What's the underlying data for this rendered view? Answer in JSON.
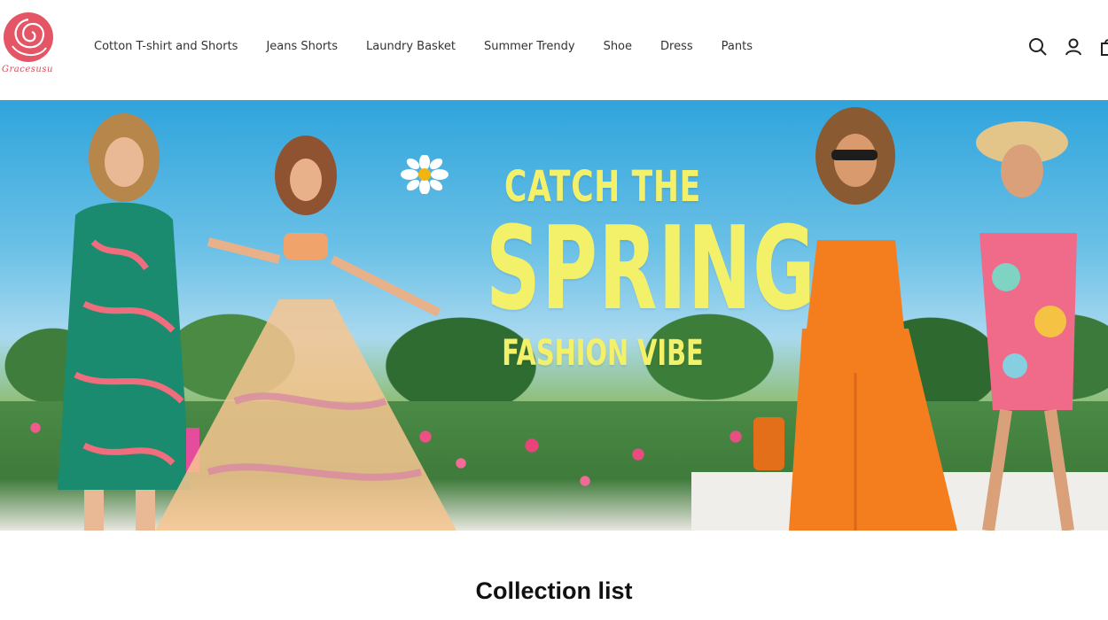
{
  "brand": {
    "logo_text": "Gracesusu",
    "logo_color": "#e45566"
  },
  "nav": {
    "items": [
      "Cotton T-shirt and Shorts",
      "Jeans Shorts",
      "Laundry Basket",
      "Summer Trendy",
      "Shoe",
      "Dress",
      "Pants"
    ]
  },
  "header_icons": [
    "search-icon",
    "account-icon",
    "cart-icon"
  ],
  "hero": {
    "line1": "CATCH THE",
    "line2": "SPRING",
    "line3": "FASHION VIBE",
    "text_color": "#f3f06a"
  },
  "collection": {
    "title": "Collection list"
  }
}
